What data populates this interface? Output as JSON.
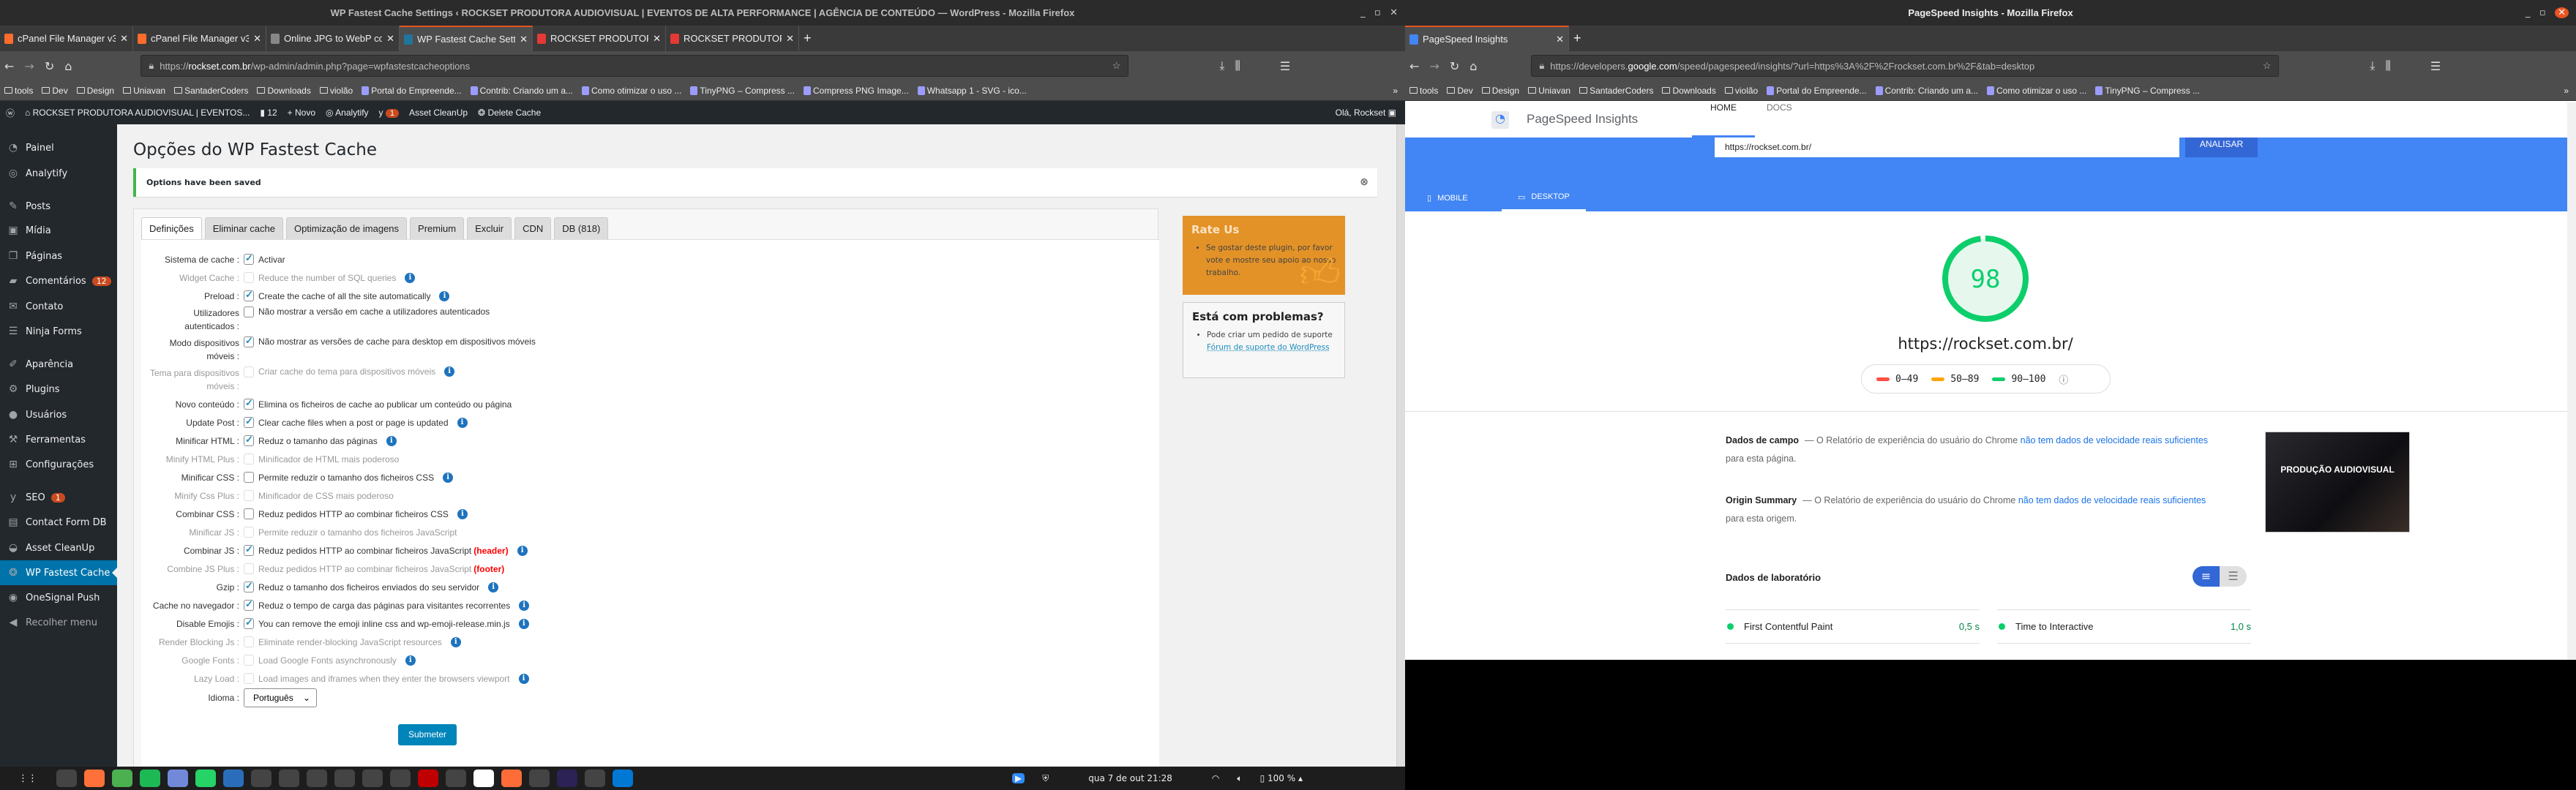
{
  "left_window": {
    "title": "WP Fastest Cache Settings ‹ ROCKSET PRODUTORA AUDIOVISUAL | EVENTOS DE ALTA PERFORMANCE | AGÊNCIA DE CONTEÚDO — WordPress - Mozilla Firefox",
    "tabs": [
      {
        "label": "cPanel File Manager v3",
        "icon": "cpanel-icon",
        "color": "#ff6c2c"
      },
      {
        "label": "cPanel File Manager v3 -",
        "icon": "cpanel-icon",
        "color": "#ff6c2c"
      },
      {
        "label": "Online JPG to WebP con",
        "icon": "converter-icon",
        "color": "#888"
      },
      {
        "label": "WP Fastest Cache Settin",
        "icon": "wordpress-icon",
        "color": "#21759b",
        "active": true
      },
      {
        "label": "ROCKSET PRODUTORA /",
        "icon": "rockset-icon",
        "color": "#e53935"
      },
      {
        "label": "ROCKSET PRODUTORA /",
        "icon": "rockset-icon",
        "color": "#e53935"
      }
    ],
    "url_prefix": "https://",
    "url_domain": "rockset.com.br",
    "url_path": "/wp-admin/admin.php?page=wpfastestcacheoptions",
    "bookmarks": [
      "tools",
      "Dev",
      "Design",
      "Uniavan",
      "SantaderCoders",
      "Downloads",
      "violão",
      "Portal do Empreende...",
      "Contrib: Criando um a...",
      "Como otimizar o uso ...",
      "TinyPNG – Compress ...",
      "Compress PNG Image...",
      "Whatsapp 1 - SVG - ico..."
    ],
    "adminbar": {
      "site": "ROCKSET PRODUTORA AUDIOVISUAL | EVENTOS...",
      "comments": "12",
      "new": "Novo",
      "analytify": "Analytify",
      "seo_badge": "1",
      "asset": "Asset CleanUp",
      "delete_cache": "Delete Cache",
      "greeting": "Olá, Rockset"
    },
    "sidebar": [
      {
        "label": "Painel",
        "icon": "dashboard-icon",
        "glyph": "◔"
      },
      {
        "label": "Analytify",
        "icon": "analytics-icon",
        "glyph": "◎"
      },
      {
        "label": "Posts",
        "icon": "pin-icon",
        "glyph": "✎"
      },
      {
        "label": "Mídia",
        "icon": "media-icon",
        "glyph": "▣"
      },
      {
        "label": "Páginas",
        "icon": "pages-icon",
        "glyph": "❐"
      },
      {
        "label": "Comentários",
        "icon": "comment-icon",
        "glyph": "▰",
        "badge": "12"
      },
      {
        "label": "Contato",
        "icon": "mail-icon",
        "glyph": "✉"
      },
      {
        "label": "Ninja Forms",
        "icon": "forms-icon",
        "glyph": "☰"
      },
      {
        "label": "Aparência",
        "icon": "brush-icon",
        "glyph": "✐"
      },
      {
        "label": "Plugins",
        "icon": "plugin-icon",
        "glyph": "⚙"
      },
      {
        "label": "Usuários",
        "icon": "user-icon",
        "glyph": "●"
      },
      {
        "label": "Ferramentas",
        "icon": "wrench-icon",
        "glyph": "⚒"
      },
      {
        "label": "Configurações",
        "icon": "settings-icon",
        "glyph": "⊞"
      },
      {
        "label": "SEO",
        "icon": "yoast-icon",
        "glyph": "y",
        "badge": "1"
      },
      {
        "label": "Contact Form DB",
        "icon": "database-icon",
        "glyph": "▤"
      },
      {
        "label": "Asset CleanUp",
        "icon": "gauge-icon",
        "glyph": "◒"
      },
      {
        "label": "WP Fastest Cache",
        "icon": "cheetah-icon",
        "glyph": "❂",
        "active": true
      },
      {
        "label": "OneSignal Push",
        "icon": "signal-icon",
        "glyph": "◉"
      },
      {
        "label": "Recolher menu",
        "icon": "collapse-icon",
        "glyph": "◀",
        "muted": true
      }
    ],
    "page_title": "Opções do WP Fastest Cache",
    "notice": "Options have been saved",
    "plugin_tabs": [
      "Definições",
      "Eliminar cache",
      "Optimização de imagens",
      "Premium",
      "Excluir",
      "CDN",
      "DB (818)"
    ],
    "settings": [
      {
        "label": "Sistema de cache :",
        "text": "Activar",
        "checked": true
      },
      {
        "label": "Widget Cache :",
        "text": "Reduce the number of SQL queries",
        "disabled": true,
        "info": true
      },
      {
        "label": "Preload :",
        "text": "Create the cache of all the site automatically",
        "checked": true,
        "info": true
      },
      {
        "label": "Utilizadores autenticados :",
        "text": "Não mostrar a versão em cache a utilizadores autenticados",
        "double": true
      },
      {
        "label": "Modo dispositivos móveis :",
        "text": "Não mostrar as versões de cache para desktop em dispositivos móveis",
        "checked": true,
        "double": true
      },
      {
        "label": "Tema para dispositivos móveis :",
        "text": "Criar cache do tema para dispositivos móveis",
        "disabled": true,
        "info": true,
        "double": true
      },
      {
        "label": "Novo conteúdo :",
        "text": "Elimina os ficheiros de cache ao publicar um conteúdo ou página",
        "checked": true
      },
      {
        "label": "Update Post :",
        "text": "Clear cache files when a post or page is updated",
        "checked": true,
        "info": true
      },
      {
        "label": "Minificar HTML :",
        "text": "Reduz o tamanho das páginas",
        "checked": true,
        "info": true
      },
      {
        "label": "Minify HTML Plus :",
        "text": "Minificador de HTML mais poderoso",
        "disabled": true
      },
      {
        "label": "Minificar CSS :",
        "text": "Permite reduzir o tamanho dos ficheiros CSS",
        "info": true
      },
      {
        "label": "Minify Css Plus :",
        "text": "Minificador de CSS mais poderoso",
        "disabled": true
      },
      {
        "label": "Combinar CSS :",
        "text": "Reduz pedidos HTTP ao combinar ficheiros CSS",
        "info": true
      },
      {
        "label": "Minificar JS :",
        "text": "Permite reduzir o tamanho dos ficheiros JavaScript",
        "disabled": true
      },
      {
        "label": "Combinar JS :",
        "text": "Reduz pedidos HTTP ao combinar ficheiros JavaScript",
        "tag": "(header)",
        "checked": true,
        "info": true
      },
      {
        "label": "Combine JS Plus :",
        "text": "Reduz pedidos HTTP ao combinar ficheiros JavaScript",
        "tag": "(footer)",
        "disabled": true
      },
      {
        "label": "Gzip :",
        "text": "Reduz o tamanho dos ficheiros enviados do seu servidor",
        "checked": true,
        "info": true
      },
      {
        "label": "Cache no navegador :",
        "text": "Reduz o tempo de carga das páginas para visitantes recorrentes",
        "checked": true,
        "info": true
      },
      {
        "label": "Disable Emojis :",
        "text": "You can remove the emoji inline css and wp-emoji-release.min.js",
        "checked": true,
        "info": true
      },
      {
        "label": "Render Blocking Js :",
        "text": "Eliminate render-blocking JavaScript resources",
        "disabled": true,
        "info": true
      },
      {
        "label": "Google Fonts :",
        "text": "Load Google Fonts asynchronously",
        "disabled": true,
        "info": true
      },
      {
        "label": "Lazy Load :",
        "text": "Load images and iframes when they enter the browsers viewport",
        "disabled": true,
        "info": true
      }
    ],
    "language_label": "Idioma :",
    "language_value": "Português",
    "submit": "Submeter",
    "rate": {
      "title": "Rate Us",
      "text": "Se gostar deste plugin, por favor vote e mostre seu apoio ao nosso trabalho."
    },
    "problems": {
      "title": "Está com problemas?",
      "text": "Pode criar um pedido de suporte ",
      "link": "Fórum de suporte do WordPress"
    }
  },
  "taskbar": {
    "apps": [
      "apps-grid-icon",
      "files-icon",
      "firefox-icon",
      "chrome-icon",
      "spotify-icon",
      "discord-icon",
      "whatsapp-icon",
      "writer-icon",
      "text-editor-icon",
      "calculator-icon",
      "inkscape-icon",
      "gimp-icon",
      "system-monitor-icon",
      "terminal-icon",
      "filezilla-icon",
      "mysql-workbench-icon",
      "mongodb-icon",
      "postman-icon",
      "figma-icon",
      "eclipse-icon",
      "qt-icon",
      "vscode-icon"
    ],
    "datetime": "qua 7 de out  21:28",
    "battery": "100 %"
  },
  "right_window": {
    "title": "PageSpeed Insights - Mozilla Firefox",
    "tab": "PageSpeed Insights",
    "url_prefix": "https://developers.",
    "url_domain": "google.com",
    "url_path": "/speed/pagespeed/insights/?url=https%3A%2F%2Frockset.com.br%2F&tab=desktop",
    "bookmarks": [
      "tools",
      "Dev",
      "Design",
      "Uniavan",
      "SantaderCoders",
      "Downloads",
      "violão",
      "Portal do Empreende...",
      "Contrib: Criando um a...",
      "Como otimizar o uso ...",
      "TinyPNG – Compress ..."
    ],
    "brand": "PageSpeed Insights",
    "nav": [
      "HOME",
      "DOCS"
    ],
    "input_value": "https://rockset.com.br/",
    "analyze": "ANALISAR",
    "device_tabs": [
      "MOBILE",
      "DESKTOP"
    ],
    "score": 98,
    "score_color": "#0cce6b",
    "tested_url": "https://rockset.com.br/",
    "legend": [
      {
        "label": "0–49",
        "color": "#ff4e42"
      },
      {
        "label": "50–89",
        "color": "#ffa400"
      },
      {
        "label": "90–100",
        "color": "#0cce6b"
      }
    ],
    "field": {
      "title": "Dados de campo",
      "pre": "— O Relatório de experiência do usuário do Chrome ",
      "link": "não tem dados de velocidade reais suficientes",
      "post": " para esta página."
    },
    "origin": {
      "title": "Origin Summary",
      "pre": "— O Relatório de experiência do usuário do Chrome ",
      "link": "não tem dados de velocidade reais suficientes",
      "post": " para esta origem."
    },
    "thumbnail_text": "PRODUÇÃO AUDIOVISUAL",
    "lab_title": "Dados de laboratório",
    "metrics": [
      {
        "label": "First Contentful Paint",
        "value": "0,5 s"
      },
      {
        "label": "Time to Interactive",
        "value": "1,0 s"
      }
    ]
  }
}
